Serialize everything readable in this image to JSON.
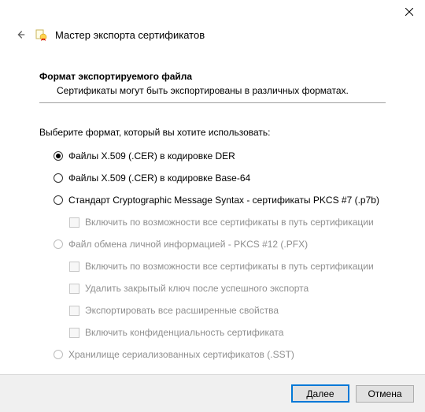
{
  "window": {
    "title": "Мастер экспорта сертификатов"
  },
  "section": {
    "title": "Формат экспортируемого файла",
    "description": "Сертификаты могут быть экспортированы в различных форматах."
  },
  "instruction": "Выберите формат, который вы хотите использовать:",
  "formats": {
    "der": "Файлы X.509 (.CER) в кодировке DER",
    "base64": "Файлы X.509 (.CER) в кодировке Base-64",
    "pkcs7": "Стандарт Cryptographic Message Syntax - сертификаты PKCS #7 (.p7b)",
    "pkcs7_include_chain": "Включить по возможности все сертификаты в путь сертификации",
    "pfx": "Файл обмена личной информацией - PKCS #12 (.PFX)",
    "pfx_include_chain": "Включить по возможности все сертификаты в путь сертификации",
    "pfx_delete_key": "Удалить закрытый ключ после успешного экспорта",
    "pfx_export_ext": "Экспортировать все расширенные свойства",
    "pfx_privacy": "Включить конфиденциальность сертификата",
    "sst": "Хранилище сериализованных сертификатов (.SST)"
  },
  "buttons": {
    "next": "Далее",
    "cancel": "Отмена"
  }
}
